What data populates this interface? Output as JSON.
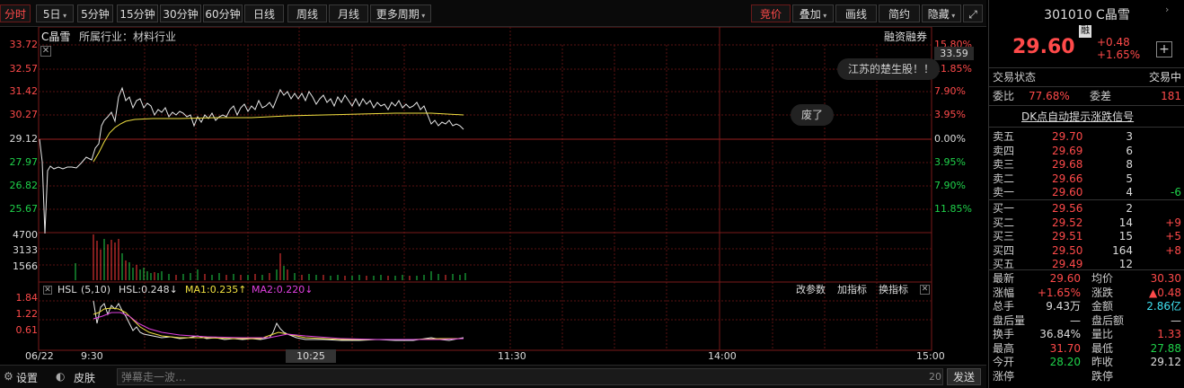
{
  "toolbar": {
    "tabs": [
      "分时",
      "5日",
      "5分钟",
      "15分钟",
      "30分钟",
      "60分钟",
      "日线",
      "周线",
      "月线",
      "更多周期"
    ],
    "right_tabs": [
      "竞价",
      "叠加",
      "画线",
      "简约",
      "隐藏"
    ],
    "expand_icon": "expand-icon"
  },
  "chart": {
    "title": "C晶雪",
    "industry": "所属行业：材料行业",
    "margin_label": "融资融券",
    "price_labels_left": [
      "33.72",
      "32.57",
      "31.42",
      "30.27",
      "29.12",
      "27.97",
      "26.82",
      "25.67"
    ],
    "pct_labels_right": [
      "15.80%",
      "11.85%",
      "7.90%",
      "3.95%",
      "0.00%",
      "3.95%",
      "7.90%",
      "11.85%"
    ],
    "current_price_tag": "33.59",
    "vol_labels": [
      "4700",
      "3133",
      "1566"
    ],
    "hsl_labels": [
      "1.84",
      "1.22",
      "0.61"
    ],
    "popup1": "江苏的楚生股！！",
    "popup2": "废了",
    "time_axis": [
      "06/22",
      "9:30",
      "10:25",
      "11:30",
      "14:00",
      "15:00"
    ],
    "indicator": {
      "name": "HSL",
      "params": "(5,10)",
      "hsl": "HSL:0.248↓",
      "ma1": "MA1:0.235↑",
      "ma2": "MA2:0.220↓",
      "buttons": [
        "改参数",
        "加指标",
        "换指标"
      ]
    }
  },
  "bottom": {
    "settings": "设置",
    "skin": "皮肤",
    "danmu_placeholder": "弹幕走一波…",
    "count": "20",
    "send": "发送"
  },
  "panel": {
    "code_name": "301010 C晶雪",
    "rong": "融",
    "price": "29.60",
    "change": "+0.48",
    "change_pct": "+1.65%",
    "status_label": "交易状态",
    "status_value": "交易中",
    "weibi_label": "委比",
    "weibi_value": "77.68%",
    "weicha_label": "委差",
    "weicha_value": "181",
    "dk_link": "DK点自动提示涨跌信号",
    "sells": [
      {
        "label": "卖五",
        "price": "29.70",
        "vol": "3",
        "chg": ""
      },
      {
        "label": "卖四",
        "price": "29.69",
        "vol": "6",
        "chg": ""
      },
      {
        "label": "卖三",
        "price": "29.68",
        "vol": "8",
        "chg": ""
      },
      {
        "label": "卖二",
        "price": "29.66",
        "vol": "5",
        "chg": ""
      },
      {
        "label": "卖一",
        "price": "29.60",
        "vol": "4",
        "chg": "-6"
      }
    ],
    "buys": [
      {
        "label": "买一",
        "price": "29.56",
        "vol": "2",
        "chg": ""
      },
      {
        "label": "买二",
        "price": "29.52",
        "vol": "14",
        "chg": "+9"
      },
      {
        "label": "买三",
        "price": "29.51",
        "vol": "15",
        "chg": "+5"
      },
      {
        "label": "买四",
        "price": "29.50",
        "vol": "164",
        "chg": "+8"
      },
      {
        "label": "买五",
        "price": "29.49",
        "vol": "12",
        "chg": ""
      }
    ],
    "stats": [
      {
        "l1": "最新",
        "v1": "29.60",
        "c1": "red",
        "l2": "均价",
        "v2": "30.30",
        "c2": "red"
      },
      {
        "l1": "涨幅",
        "v1": "+1.65%",
        "c1": "red",
        "l2": "涨跌",
        "v2": "▲0.48",
        "c2": "red"
      },
      {
        "l1": "总手",
        "v1": "9.43万",
        "c1": "white",
        "l2": "金额",
        "v2": "2.86亿",
        "c2": "cyan"
      },
      {
        "l1": "盘后量",
        "v1": "—",
        "c1": "white",
        "l2": "盘后额",
        "v2": "—",
        "c2": "white"
      },
      {
        "l1": "换手",
        "v1": "36.84%",
        "c1": "white",
        "l2": "量比",
        "v2": "1.33",
        "c2": "red"
      },
      {
        "l1": "最高",
        "v1": "31.70",
        "c1": "red",
        "l2": "最低",
        "v2": "27.88",
        "c2": "green"
      },
      {
        "l1": "今开",
        "v1": "28.20",
        "c1": "green",
        "l2": "昨收",
        "v2": "29.12",
        "c2": "white"
      },
      {
        "l1": "涨停",
        "v1": "",
        "c1": "white",
        "l2": "跌停",
        "v2": "",
        "c2": "white"
      }
    ]
  }
}
